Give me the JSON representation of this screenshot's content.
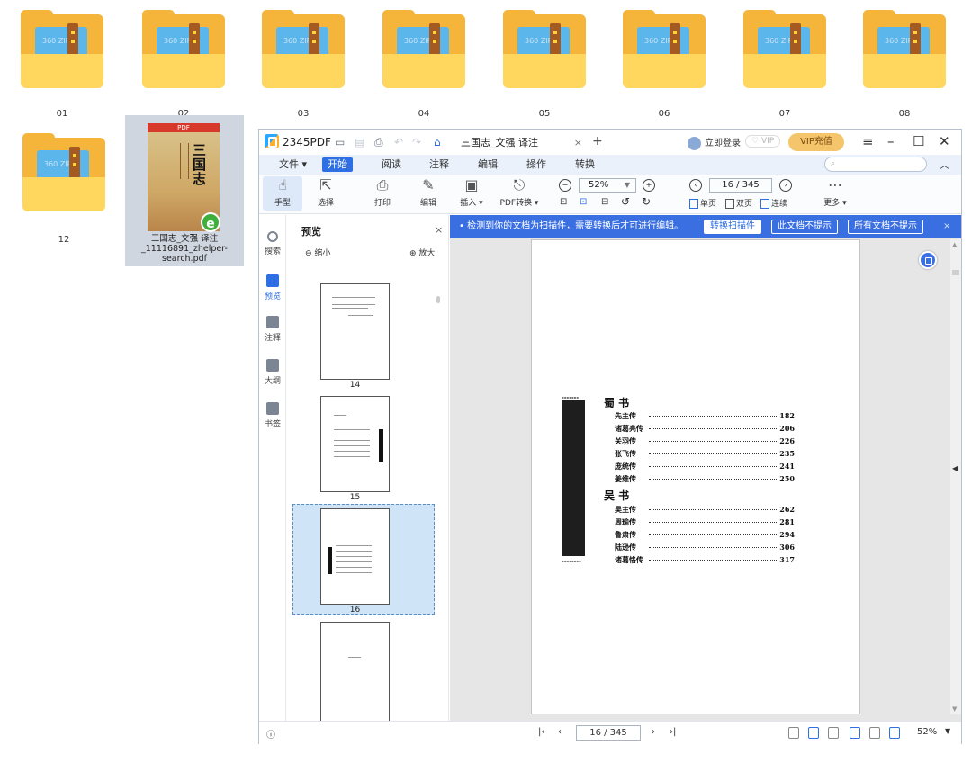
{
  "desktop": {
    "folders": [
      {
        "label": "01",
        "badge": "360 ZIP"
      },
      {
        "label": "02",
        "badge": "360 ZIP"
      },
      {
        "label": "03",
        "badge": "360 ZIP"
      },
      {
        "label": "04",
        "badge": "360 ZIP"
      },
      {
        "label": "05",
        "badge": "360 ZIP"
      },
      {
        "label": "06",
        "badge": "360 ZIP"
      },
      {
        "label": "07",
        "badge": "360 ZIP"
      },
      {
        "label": "08",
        "badge": "360 ZIP"
      },
      {
        "label": "12",
        "badge": "360 ZIP"
      }
    ],
    "pdf_file": {
      "label": "三国志_文强 译注_11116891_zhelper-search.pdf",
      "cover_banner": "PDF",
      "cover_title": "三国志"
    }
  },
  "app": {
    "name": "2345PDF",
    "doc_tab": "三国志_文强 译注_11116891...",
    "login": "立即登录",
    "vip": "VIP",
    "vip_charge": "VIP充值",
    "menu": {
      "file": "文件 ▾",
      "start": "开始",
      "read": "阅读",
      "annotate": "注释",
      "edit": "编辑",
      "operate": "操作",
      "convert": "转换"
    },
    "toolbar": {
      "hand": "手型",
      "select": "选择",
      "print": "打印",
      "edit": "编辑",
      "insert": "插入 ▾",
      "pdf_convert": "PDF转换 ▾",
      "zoom_value": "52%",
      "page_value": "16 / 345",
      "single": "单页",
      "double": "双页",
      "continuous": "连续",
      "more": "更多 ▾"
    },
    "rail": {
      "search": "搜索",
      "preview": "预览",
      "annot": "注释",
      "outline": "大纲",
      "bookmark": "书签"
    },
    "side": {
      "title": "预览",
      "zoom_out": "缩小",
      "zoom_in": "放大",
      "pages": [
        "14",
        "15",
        "16"
      ]
    },
    "banner": {
      "text": "• 检测到你的文档为扫描件，需要转换后才可进行编辑。",
      "convert": "转换扫描件",
      "no_this": "此文档不提示",
      "no_all": "所有文档不提示"
    },
    "toc": {
      "section1": "蜀  书",
      "section2": "吴  书",
      "rows1": [
        {
          "name": "先主传",
          "page": "182"
        },
        {
          "name": "诸葛亮传",
          "page": "206"
        },
        {
          "name": "关羽传",
          "page": "226"
        },
        {
          "name": "张飞传",
          "page": "235"
        },
        {
          "name": "庞统传",
          "page": "241"
        },
        {
          "name": "姜维传",
          "page": "250"
        }
      ],
      "rows2": [
        {
          "name": "吴主传",
          "page": "262"
        },
        {
          "name": "周瑜传",
          "page": "281"
        },
        {
          "name": "鲁肃传",
          "page": "294"
        },
        {
          "name": "陆逊传",
          "page": "306"
        },
        {
          "name": "诸葛恪传",
          "page": "317"
        }
      ]
    },
    "status": {
      "page_value": "16 / 345",
      "zoom": "52%"
    }
  }
}
